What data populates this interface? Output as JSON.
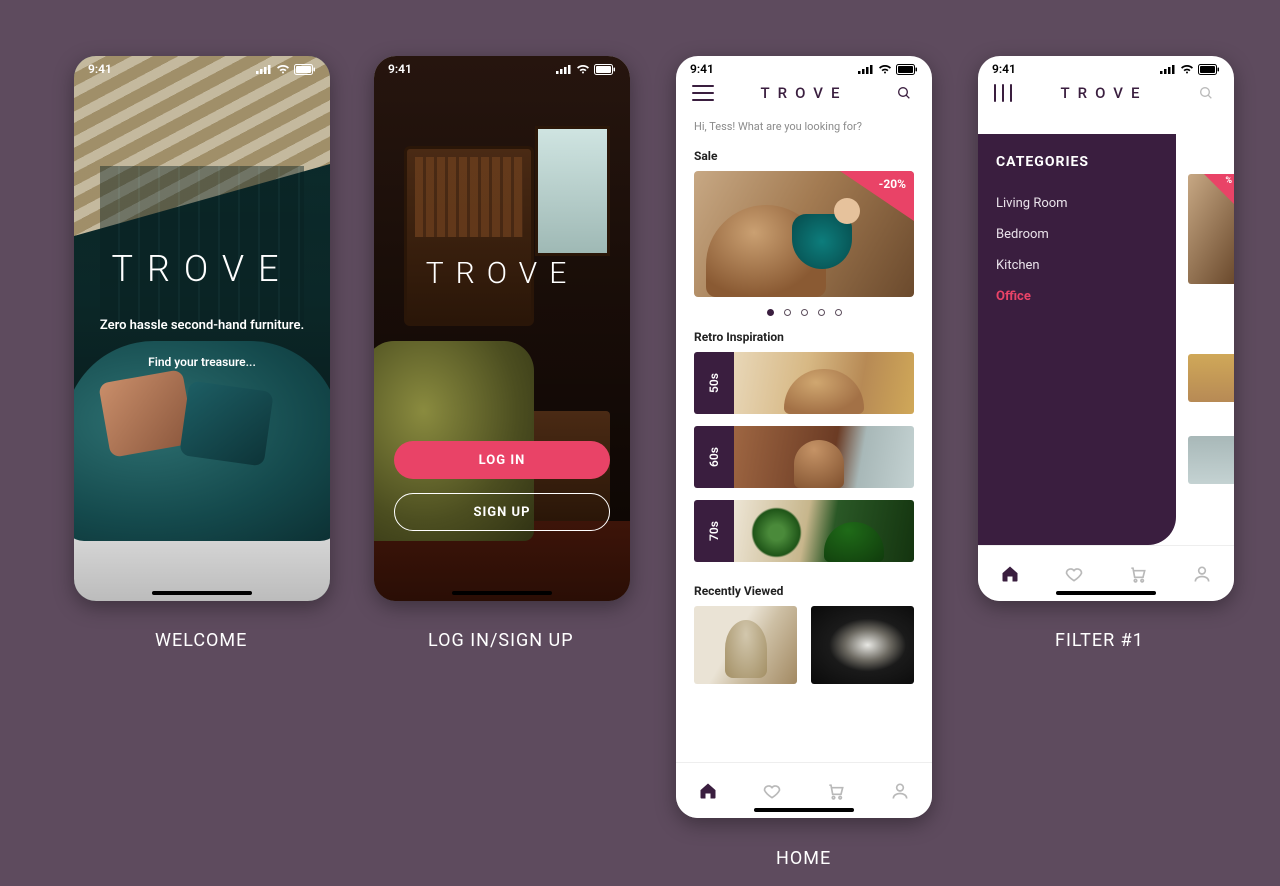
{
  "status": {
    "time": "9:41"
  },
  "captions": {
    "welcome": "WELCOME",
    "login": "LOG IN/SIGN UP",
    "home": "HOME",
    "filter": "FILTER  #1"
  },
  "brand": "TROVE",
  "welcome": {
    "tagline1": "Zero hassle second-hand furniture.",
    "tagline2": "Find your treasure..."
  },
  "auth": {
    "login_label": "LOG IN",
    "signup_label": "SIGN UP"
  },
  "home": {
    "greeting": "Hi, Tess! What are you looking for?",
    "sale_heading": "Sale",
    "sale_badge": "-20%",
    "carousel": {
      "count": 5,
      "active_index": 0
    },
    "retro_heading": "Retro Inspiration",
    "retro_items": [
      {
        "label": "50s"
      },
      {
        "label": "60s"
      },
      {
        "label": "70s"
      }
    ],
    "recent_heading": "Recently Viewed"
  },
  "filter": {
    "heading": "CATEGORIES",
    "items": [
      {
        "label": "Living Room",
        "active": false
      },
      {
        "label": "Bedroom",
        "active": false
      },
      {
        "label": "Kitchen",
        "active": false
      },
      {
        "label": "Office",
        "active": true
      }
    ],
    "peek_badge": "%"
  }
}
